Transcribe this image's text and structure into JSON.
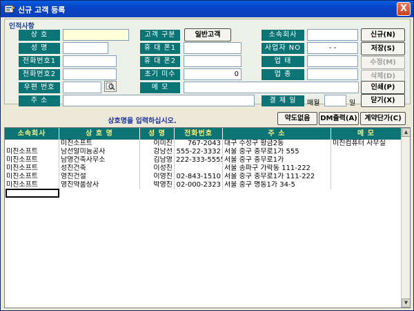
{
  "window": {
    "title": "신규 고객 등록",
    "close_glyph": "X"
  },
  "form": {
    "group_caption": "인적사항",
    "labels": {
      "company": "상 호",
      "name": "성 명",
      "phone1": "전화번호1",
      "phone2": "전화번호2",
      "zip": "우편 번호",
      "address": "주 소",
      "customer_type": "고객 구분",
      "mobile1": "휴 대 폰1",
      "mobile2": "휴 대 폰2",
      "initial_unpaid": "초기 미수",
      "memo": "메 모",
      "affiliate": "소속회사",
      "business_no": "사업자 NO",
      "business_type": "업 태",
      "business_item": "업 종",
      "payment_day": "결 제 일"
    },
    "values": {
      "company": "",
      "name": "",
      "phone1": "",
      "phone2": "",
      "zip": "",
      "address": "",
      "mobile1": "",
      "mobile2": "",
      "initial_unpaid": "0",
      "memo": "",
      "affiliate": "",
      "business_no": "- -",
      "business_type": "",
      "business_item": "",
      "payment_day": ""
    },
    "customer_type_button": "일반고객",
    "payment_prefix": "매월",
    "payment_suffix": "일"
  },
  "actions": {
    "new": "신규(N)",
    "save": "저장(S)",
    "edit": "수정(M)",
    "delete": "삭제(D)",
    "print": "인쇄(P)",
    "close": "닫기(X)"
  },
  "status_message": "상호명을 입력하십시오.",
  "toolbar": {
    "no_abbrev": "약도없음",
    "dm_print": "DM출력(A)",
    "contract_price": "계약단가(C)"
  },
  "grid": {
    "columns": [
      "소속회사",
      "상 호 명",
      "성 명",
      "전화번호",
      "주 소",
      "메 모"
    ],
    "rows": [
      [
        "",
        "미진소프트",
        "이미진",
        "767-2043",
        "대구 수성구 황금2동",
        "미진컴퓨터 사무실"
      ],
      [
        "미진소프트",
        "남선알미늄공사",
        "강남선",
        "555-22-3332",
        "서울 중구 충무로1가 555",
        ""
      ],
      [
        "미진소프트",
        "남영건축사무소",
        "김남영",
        "222-333-5555",
        "서울 중구 충무로1가",
        ""
      ],
      [
        "미진소프트",
        "성진건축",
        "이성진",
        "",
        "서울 송파구 가락동 111-222",
        ""
      ],
      [
        "미진소프트",
        "영진건설",
        "이영진",
        "02-843-1510",
        "서울 중구 충무로1가 111-222",
        ""
      ],
      [
        "미진소프트",
        "영진약품상사",
        "박영진",
        "02-000-2323",
        "서울 중구 명동1가 34-5",
        ""
      ]
    ]
  },
  "colors": {
    "label_bg": "#0c7474",
    "header_text": "#f4f080",
    "titlebar": "#0a5ee0",
    "status_text": "#1a30a0"
  },
  "icons": {
    "app": "app-icon",
    "zip_search": "zip-search-icon",
    "close": "close-icon"
  }
}
